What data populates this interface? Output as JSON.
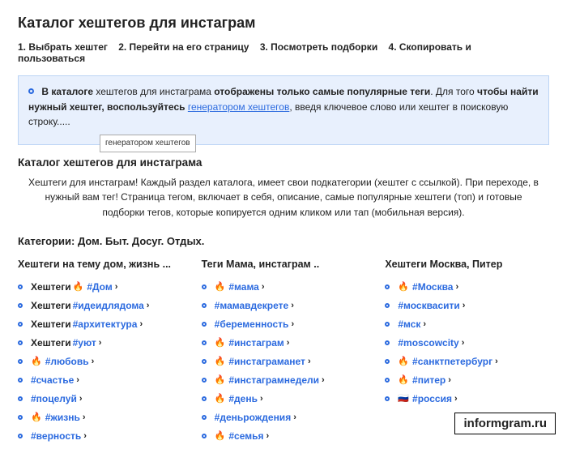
{
  "title": "Каталог хештегов для инстаграм",
  "steps": [
    "1. Выбрать хештег",
    "2. Перейти на его страницу",
    "3. Посмотреть подборки",
    "4. Скопировать и пользоваться"
  ],
  "infobox": {
    "strong1": "В каталоге",
    "text1": " хештегов для инстаграма ",
    "strong2": "отображены только самые популярные теги",
    "text2": ". Для того ",
    "strong3": "чтобы найти нужный хештег, воспользуйтесь ",
    "link": "генератором хештегов",
    "text3": ", введя ключевое слово или хештег в поисковую строку....."
  },
  "tooltip": "генератором хештегов",
  "subtitle": "Каталог хештегов для инстаграма",
  "intro": "Хештеги для инстаграм! Каждый раздел каталога, имеет свои подкатегории (хештег с ссылкой). При переходе, в нужный вам тег! Страница тегом, включает в себя, описание, самые популярные хештеги (топ) и готовые подборки тегов, которые копируется одним кликом или тап (мобильная версия).",
  "cats_heading": "Категории: Дом. Быт. Досуг. Отдых.",
  "columns": [
    {
      "title": "Хештеги на тему дом, жизнь ...",
      "items": [
        {
          "text": "#Дом",
          "fire": true,
          "prefix": "Хештеги"
        },
        {
          "text": "#идеидлядома",
          "fire": false,
          "prefix": "Хештеги"
        },
        {
          "text": "#архитектура",
          "fire": false,
          "prefix": "Хештеги"
        },
        {
          "text": "#уют",
          "fire": false,
          "prefix": "Хештеги"
        },
        {
          "text": "#любовь",
          "fire": true
        },
        {
          "text": "#счастье",
          "fire": false
        },
        {
          "text": "#поцелуй",
          "fire": false
        },
        {
          "text": "#жизнь",
          "fire": true
        },
        {
          "text": "#верность",
          "fire": false
        }
      ]
    },
    {
      "title": "Теги Мама, инстаграм ..",
      "items": [
        {
          "text": "#мама",
          "fire": true
        },
        {
          "text": "#мамавдекрете",
          "fire": false
        },
        {
          "text": "#беременность",
          "fire": false
        },
        {
          "text": "#инстаграм",
          "fire": true
        },
        {
          "text": "#инстаграманет",
          "fire": true
        },
        {
          "text": "#инстаграмнедели",
          "fire": true
        },
        {
          "text": "#день",
          "fire": true
        },
        {
          "text": "#деньрождения",
          "fire": false
        },
        {
          "text": "#семья",
          "fire": true
        }
      ]
    },
    {
      "title": "Хештеги Москва, Питер",
      "items": [
        {
          "text": "#Москва",
          "fire": true
        },
        {
          "text": "#москвасити",
          "fire": false
        },
        {
          "text": "#мск",
          "fire": false
        },
        {
          "text": "#moscowcity",
          "fire": false
        },
        {
          "text": "#санктпетербург",
          "fire": true
        },
        {
          "text": "#питер",
          "fire": true
        },
        {
          "text": "#россия",
          "flag": true
        }
      ]
    }
  ],
  "watermark": "informgram.ru"
}
